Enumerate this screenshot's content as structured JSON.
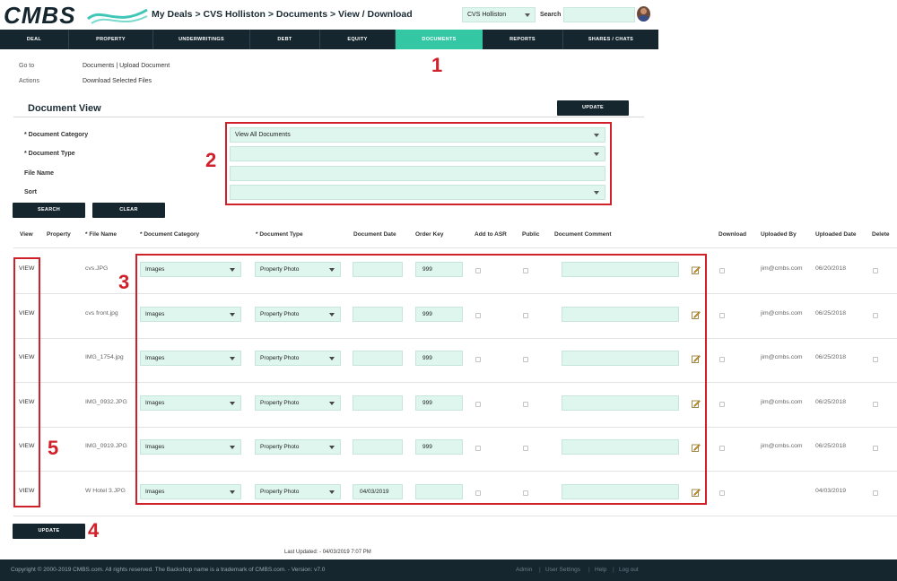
{
  "header": {
    "logo_text": "CMBS",
    "breadcrumb": "My Deals > CVS Holliston > Documents > View / Download",
    "deal_select": "CVS Holliston",
    "search_label": "Search",
    "search_value": ""
  },
  "nav": {
    "tabs": [
      {
        "label": "DEAL",
        "active": false
      },
      {
        "label": "PROPERTY",
        "active": false
      },
      {
        "label": "UNDERWRITINGS",
        "active": false
      },
      {
        "label": "DEBT",
        "active": false
      },
      {
        "label": "EQUITY",
        "active": false
      },
      {
        "label": "DOCUMENTS",
        "active": true
      },
      {
        "label": "REPORTS",
        "active": false
      },
      {
        "label": "SHARES / CHATS",
        "active": false
      }
    ]
  },
  "annotations": {
    "n1": "1",
    "n2": "2",
    "n3": "3",
    "n4": "4",
    "n5": "5"
  },
  "meta": {
    "goto_label": "Go to",
    "goto_links": "Documents | Upload Document",
    "actions_label": "Actions",
    "actions_link": "Download Selected Files"
  },
  "document_view": {
    "title": "Document View",
    "update_label": "UPDATE",
    "fields": {
      "category_label": "* Document Category",
      "category_value": "View All Documents",
      "type_label": "* Document Type",
      "type_value": "",
      "filename_label": "File Name",
      "filename_value": "",
      "sort_label": "Sort",
      "sort_value": ""
    },
    "search_label": "SEARCH",
    "clear_label": "CLEAR"
  },
  "table": {
    "headers": {
      "view": "View",
      "property": "Property",
      "file_name": "* File Name",
      "doc_category": "* Document Category",
      "doc_type": "* Document Type",
      "doc_date": "Document Date",
      "order_key": "Order Key",
      "add_to_asr": "Add to ASR",
      "public": "Public",
      "doc_comment": "Document Comment",
      "download": "Download",
      "uploaded_by": "Uploaded By",
      "uploaded_date": "Uploaded Date",
      "delete": "Delete"
    },
    "rows": [
      {
        "view": "VIEW",
        "file": "cvs.JPG",
        "category": "Images",
        "type": "Property Photo",
        "date": "",
        "order_key": "999",
        "uploaded_by": "jim@cmbs.com",
        "uploaded_date": "06/20/2018"
      },
      {
        "view": "VIEW",
        "file": "cvs front.jpg",
        "category": "Images",
        "type": "Property Photo",
        "date": "",
        "order_key": "999",
        "uploaded_by": "jim@cmbs.com",
        "uploaded_date": "06/25/2018"
      },
      {
        "view": "VIEW",
        "file": "IMG_1754.jpg",
        "category": "Images",
        "type": "Property Photo",
        "date": "",
        "order_key": "999",
        "uploaded_by": "jim@cmbs.com",
        "uploaded_date": "06/25/2018"
      },
      {
        "view": "VIEW",
        "file": "IMG_0932.JPG",
        "category": "Images",
        "type": "Property Photo",
        "date": "",
        "order_key": "999",
        "uploaded_by": "jim@cmbs.com",
        "uploaded_date": "06/25/2018"
      },
      {
        "view": "VIEW",
        "file": "IMG_0919.JPG",
        "category": "Images",
        "type": "Property Photo",
        "date": "",
        "order_key": "999",
        "uploaded_by": "jim@cmbs.com",
        "uploaded_date": "06/25/2018"
      },
      {
        "view": "VIEW",
        "file": "W Hotel 3.JPG",
        "category": "Images",
        "type": "Property Photo",
        "date": "04/03/2019",
        "order_key": "",
        "uploaded_by": "",
        "uploaded_date": "04/03/2019"
      }
    ]
  },
  "bottom": {
    "update_label": "UPDATE",
    "last_updated": "Last Updated: - 04/03/2019 7:07 PM"
  },
  "footer": {
    "copyright": "Copyright © 2000-2019 CMBS.com. All rights reserved. The Backshop name is a trademark of CMBS.com. - Version: v7.0",
    "links": [
      "Admin",
      "User Settings",
      "Help",
      "Log out"
    ]
  },
  "colors": {
    "navy": "#15262f",
    "accent": "#34c7a4",
    "field_bg": "#dff6ee",
    "annotation_red": "#d0202a"
  }
}
